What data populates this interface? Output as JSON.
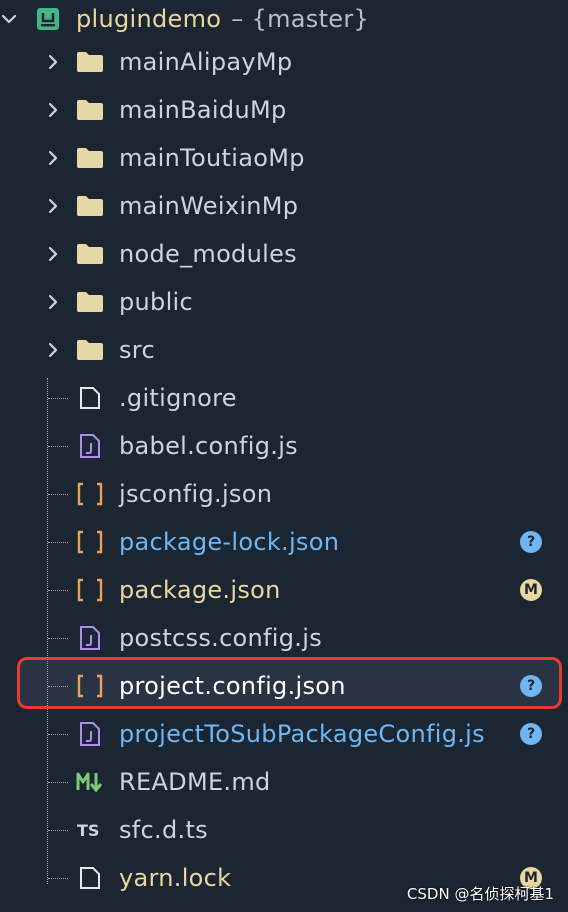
{
  "root": {
    "name": "plugindemo",
    "branch": "– {master}"
  },
  "folders": [
    {
      "name": "mainAlipayMp"
    },
    {
      "name": "mainBaiduMp"
    },
    {
      "name": "mainToutiaoMp"
    },
    {
      "name": "mainWeixinMp"
    },
    {
      "name": "node_modules"
    },
    {
      "name": "public"
    },
    {
      "name": "src"
    }
  ],
  "files": [
    {
      "name": ".gitignore",
      "icon": "file-icon",
      "color": "#cfd3da",
      "badge": ""
    },
    {
      "name": "babel.config.js",
      "icon": "js-file-icon",
      "color": "#cfd3da",
      "badge": ""
    },
    {
      "name": "jsconfig.json",
      "icon": "json-icon",
      "color": "#cfd3da",
      "badge": ""
    },
    {
      "name": "package-lock.json",
      "icon": "json-icon",
      "color": "#6cb7f4",
      "badge": "?"
    },
    {
      "name": "package.json",
      "icon": "json-icon",
      "color": "#e8d79e",
      "badge": "M"
    },
    {
      "name": "postcss.config.js",
      "icon": "js-file-icon",
      "color": "#cfd3da",
      "badge": ""
    },
    {
      "name": "project.config.json",
      "icon": "json-icon",
      "color": "#ffffff",
      "badge": "?"
    },
    {
      "name": "projectToSubPackageConfig.js",
      "icon": "js-file-icon",
      "color": "#6cb7f4",
      "badge": "?"
    },
    {
      "name": "README.md",
      "icon": "markdown-icon",
      "color": "#cfd3da",
      "badge": ""
    },
    {
      "name": "sfc.d.ts",
      "icon": "typescript-icon",
      "color": "#cfd3da",
      "badge": ""
    },
    {
      "name": "yarn.lock",
      "icon": "file-icon",
      "color": "#e8d79e",
      "badge": "M"
    }
  ],
  "watermark": "CSDN @名侦探柯基1",
  "colors": {
    "background": "#1c2532",
    "folder": "#e8d7a6",
    "json_bracket": "#e8a25a",
    "js_icon": "#b08cf0",
    "markdown": "#7cc97a",
    "highlight_border": "#e53b30",
    "vue_icon": "#40b883"
  }
}
